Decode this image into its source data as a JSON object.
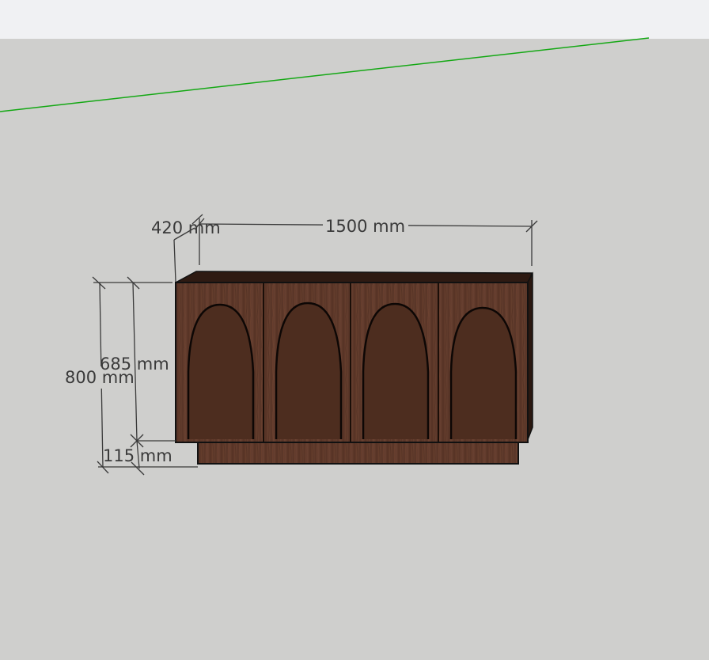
{
  "dimensions": {
    "depth": "420 mm",
    "width": "1500 mm",
    "total_height": "800 mm",
    "body_height": "685 mm",
    "plinth_height": "115 mm"
  },
  "colors": {
    "background": "#cfcfcd",
    "toolbar": "#f0f1f3",
    "axis_green": "#14a814",
    "wood_dark": "#4a2c1e",
    "wood_mid": "#5e3a28",
    "dimension_line": "#3a3a3a"
  },
  "cabinet": {
    "door_count": 4,
    "door_style": "arched"
  }
}
